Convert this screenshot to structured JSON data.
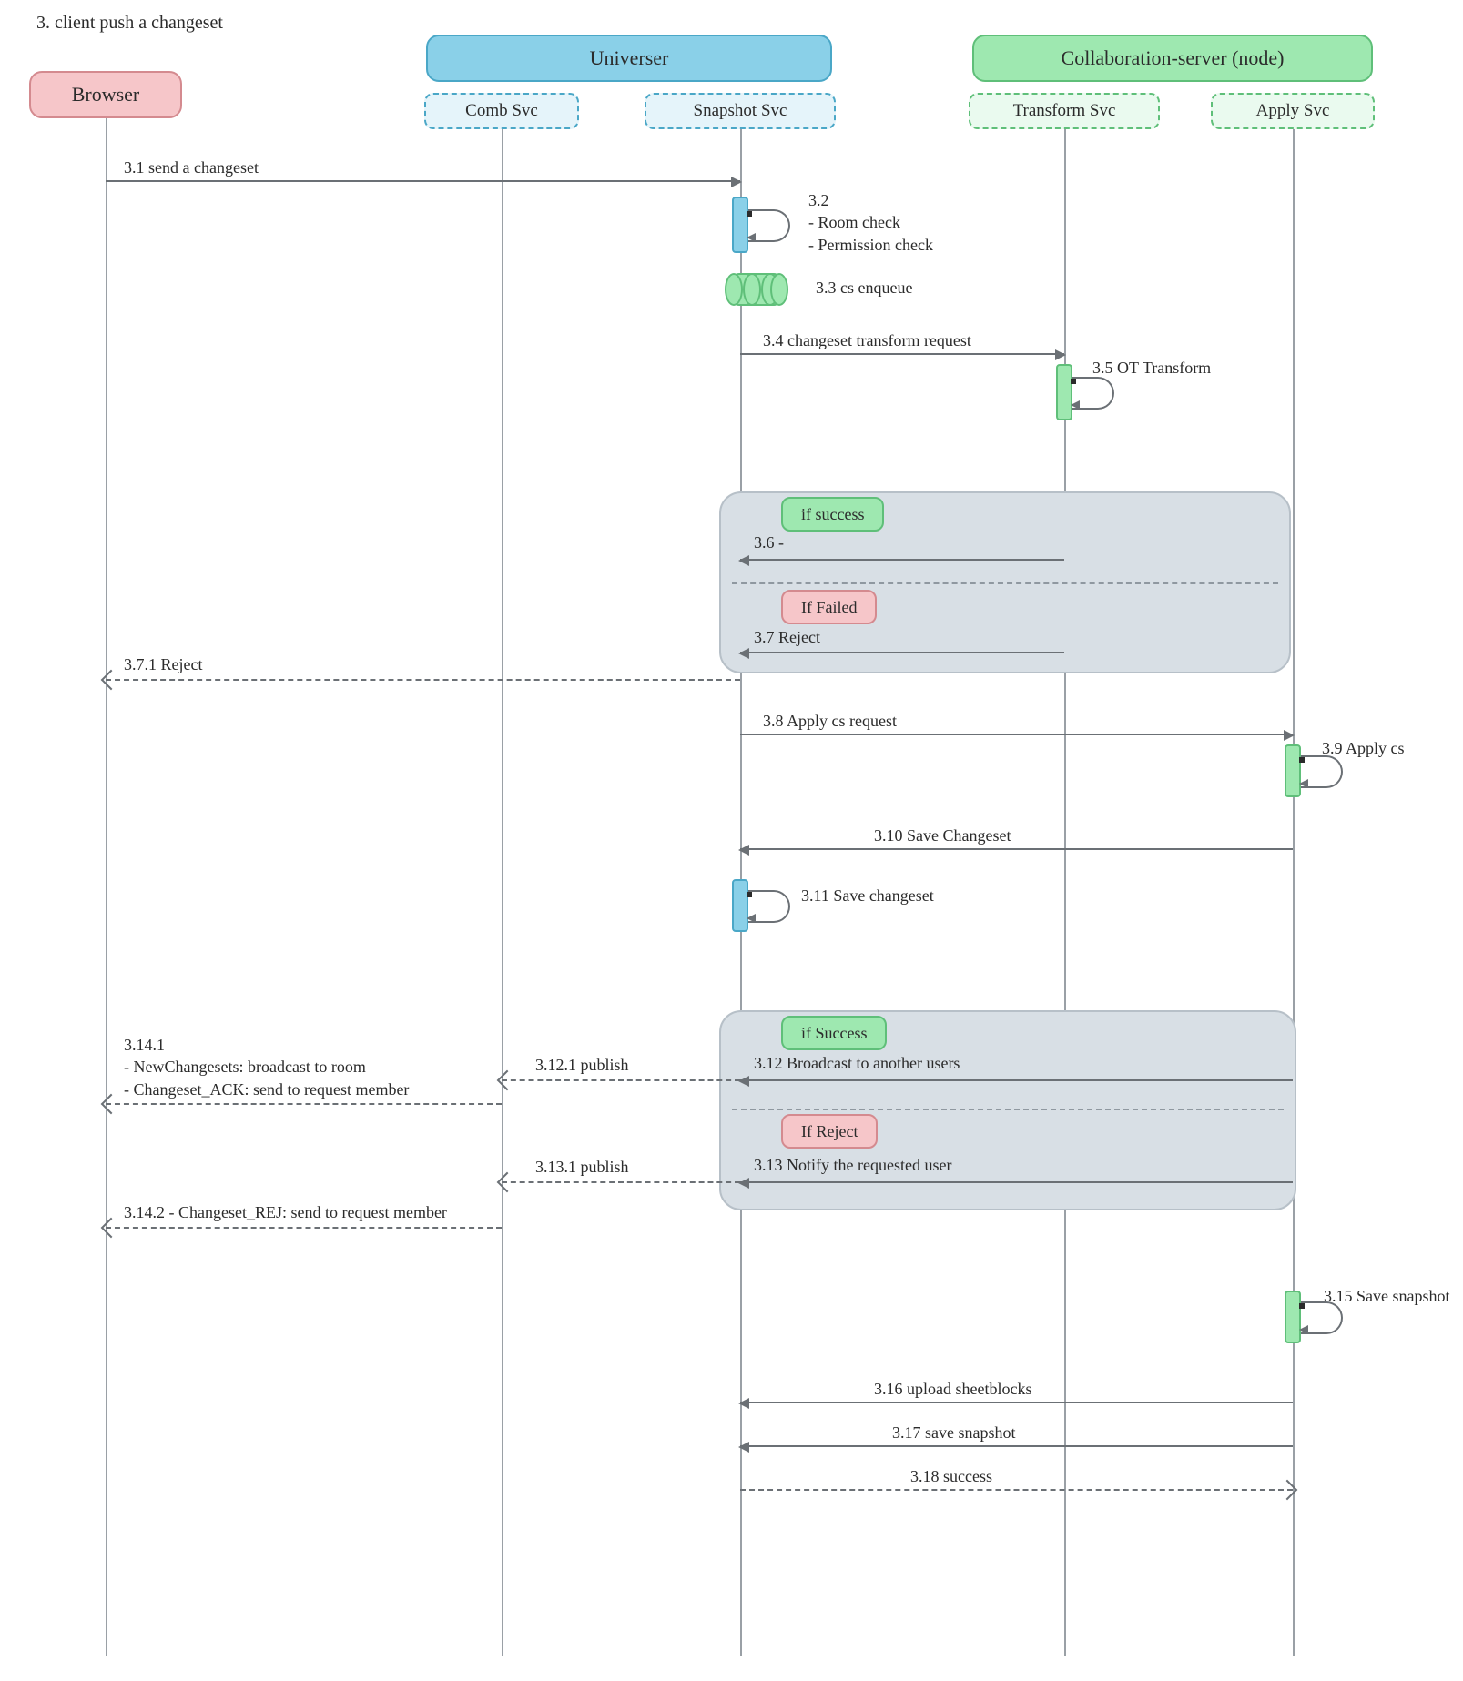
{
  "title": "3. client push a changeset",
  "participants": {
    "browser": "Browser",
    "univerServer": "Universer",
    "collabServer": "Collaboration-server (node)"
  },
  "subs": {
    "comb": "Comb Svc",
    "snapshot": "Snapshot Svc",
    "transform": "Transform Svc",
    "apply": "Apply Svc"
  },
  "msgs": {
    "m31": "3.1 send a changeset",
    "m32_num": "3.2",
    "m32_l1": "- Room check",
    "m32_l2": "- Permission check",
    "m33": "3.3 cs enqueue",
    "m34": "3.4 changeset transform request",
    "m35": "3.5 OT Transform",
    "m36": "3.6 -",
    "m37": "3.7 Reject",
    "m371": "3.7.1 Reject",
    "m38": "3.8 Apply cs request",
    "m39": "3.9 Apply cs",
    "m310": "3.10 Save Changeset",
    "m311": "3.11 Save changeset",
    "m312": "3.12 Broadcast to another users",
    "m3121": "3.12.1 publish",
    "m313": "3.13 Notify the requested user",
    "m3131": "3.13.1 publish",
    "m3141_num": "3.14.1",
    "m3141_l1": "- NewChangesets: broadcast to room",
    "m3141_l2": "- Changeset_ACK: send to request member",
    "m3142": "3.14.2 - Changeset_REJ: send to request member",
    "m315": "3.15 Save snapshot",
    "m316": "3.16 upload sheetblocks",
    "m317": "3.17 save snapshot",
    "m318": "3.18 success"
  },
  "altTags": {
    "success1": "if success",
    "failed1": "If Failed",
    "success2": "if Success",
    "reject2": "If Reject"
  }
}
